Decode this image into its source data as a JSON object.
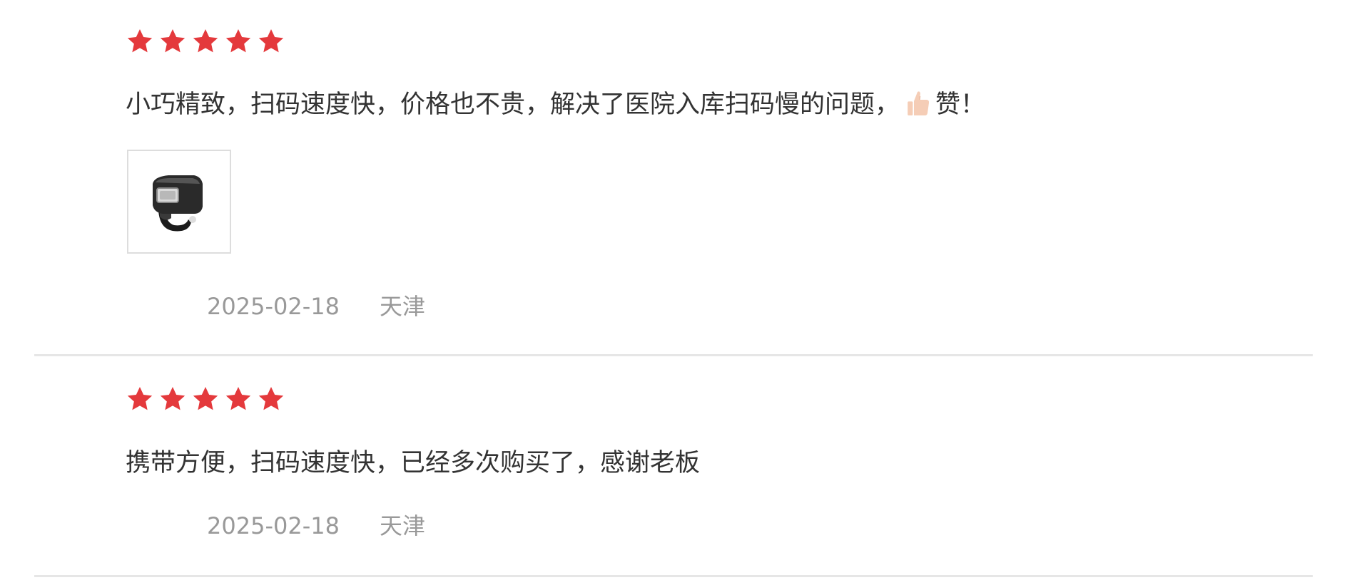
{
  "reviews": [
    {
      "rating": 5,
      "max_rating": 5,
      "text_before_icon": "小巧精致，扫码速度快，价格也不贵，解决了医院入库扫码慢的问题，",
      "inline_icon": "thumbs-up-icon",
      "text_after_icon": "赞！",
      "photo_icon": "ring-barcode-scanner-icon",
      "date": "2025-02-18",
      "location": "天津"
    },
    {
      "rating": 5,
      "max_rating": 5,
      "text": "携带方便，扫码速度快，已经多次购买了，感谢老板",
      "date": "2025-02-18",
      "location": "天津"
    }
  ],
  "colors": {
    "star": "#e4393c",
    "text": "#333333",
    "meta": "#999999",
    "divider": "#e6e6e6",
    "thumb": "#f5cdb6"
  }
}
